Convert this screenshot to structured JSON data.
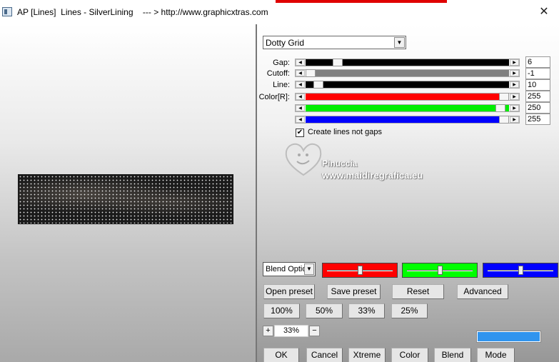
{
  "window": {
    "title": "AP [Lines]  Lines - SilverLining    --- > http://www.graphicxtras.com",
    "close_glyph": "✕"
  },
  "effect_dropdown": {
    "value": "Dotty Grid"
  },
  "sliders": [
    {
      "label": "Gap:",
      "value": "6",
      "fill": "#000000",
      "thumb_percent": 14
    },
    {
      "label": "Cutoff:",
      "value": "-1",
      "fill": "#808080",
      "thumb_percent": 0
    },
    {
      "label": "Line:",
      "value": "10",
      "fill": "#000000",
      "thumb_percent": 4
    },
    {
      "label": "Color[R]:",
      "value": "255",
      "fill": "#ff0000",
      "thumb_percent": 100
    },
    {
      "label": "",
      "value": "250",
      "fill": "#00ee00",
      "thumb_percent": 98
    },
    {
      "label": "",
      "value": "255",
      "fill": "#0000ff",
      "thumb_percent": 100
    }
  ],
  "checkbox": {
    "label": "Create lines not gaps",
    "checked": true,
    "mark": "✔"
  },
  "watermark": {
    "name": "Pinuccia",
    "url": "www.maidiregrafica.eu"
  },
  "blend": {
    "select_value": "Blend Optio",
    "mixers": [
      {
        "color": "#ff0000",
        "level_percent": 50
      },
      {
        "color": "#00ff00",
        "level_percent": 50
      },
      {
        "color": "#0000ff",
        "level_percent": 50
      }
    ]
  },
  "buttons": {
    "open_preset": "Open preset",
    "save_preset": "Save preset",
    "reset": "Reset",
    "advanced": "Advanced",
    "z100": "100%",
    "z50": "50%",
    "z33": "33%",
    "z25": "25%",
    "ok": "OK",
    "cancel": "Cancel",
    "xtreme": "Xtreme",
    "color": "Color",
    "blend": "Blend",
    "mode": "Mode"
  },
  "zoom": {
    "plus": "+",
    "value": "33%",
    "minus": "−"
  },
  "colors": {
    "swatch": "#3094ee",
    "top_strip": "#e00000"
  }
}
